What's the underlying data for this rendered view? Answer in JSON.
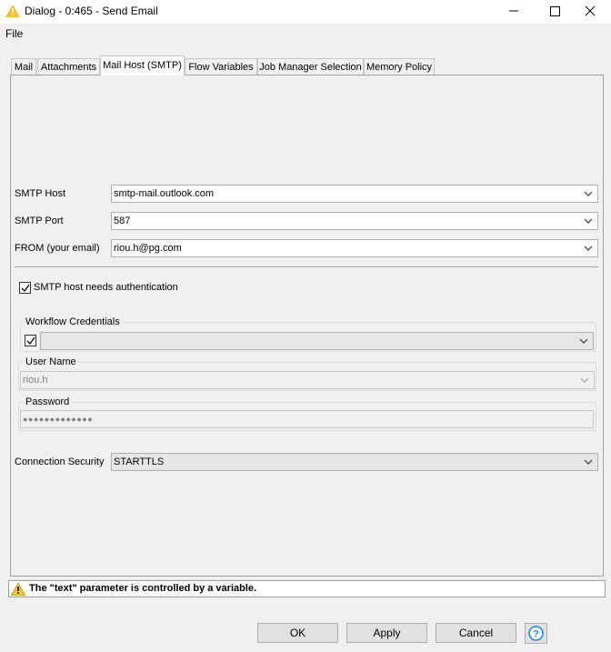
{
  "window": {
    "title": "Dialog - 0:465 - Send Email",
    "icon": "warning-triangle-icon",
    "controls": [
      "minimize-icon",
      "maximize-icon",
      "close-icon"
    ]
  },
  "menu": {
    "file": "File"
  },
  "tabs": [
    {
      "label": "Mail",
      "active": false
    },
    {
      "label": "Attachments",
      "active": false
    },
    {
      "label": "Mail Host (SMTP)",
      "active": true
    },
    {
      "label": "Flow Variables",
      "active": false
    },
    {
      "label": "Job Manager Selection",
      "active": false
    },
    {
      "label": "Memory Policy",
      "active": false
    }
  ],
  "smtp": {
    "host_label": "SMTP Host",
    "host_value": "smtp-mail.outlook.com",
    "port_label": "SMTP Port",
    "port_value": "587",
    "from_label": "FROM (your email)",
    "from_value": "riou.h@pg.com",
    "auth_label": "SMTP host needs authentication",
    "auth_checked": true
  },
  "credentials": {
    "workflow_label": "Workflow Credentials",
    "workflow_checked": true,
    "workflow_value": "",
    "username_label": "User Name",
    "username_value": "riou.h",
    "password_label": "Password",
    "password_value": "●●●●●●●●●●●●●"
  },
  "security": {
    "label": "Connection Security",
    "value": "STARTTLS"
  },
  "status": {
    "icon": "warning-triangle-icon",
    "text": "The \"text\" parameter is controlled by a variable."
  },
  "buttons": {
    "ok": "OK",
    "apply": "Apply",
    "cancel": "Cancel",
    "help_icon": "help-icon"
  },
  "colors": {
    "warning": "#f2c230",
    "help_blue": "#1e88e5",
    "panel_border": "#a0a0a0"
  }
}
